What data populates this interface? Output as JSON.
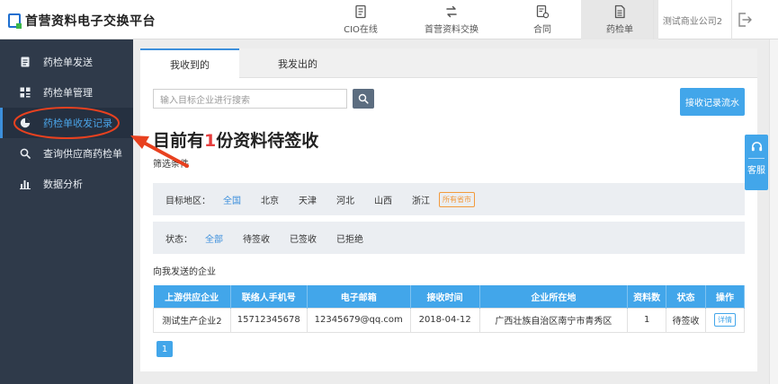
{
  "app": {
    "title": "首营资料电子交换平台"
  },
  "topnav": [
    {
      "label": "CIO在线",
      "icon": "document-icon"
    },
    {
      "label": "首营资料交换",
      "icon": "exchange-icon"
    },
    {
      "label": "合同",
      "icon": "contract-icon"
    },
    {
      "label": "药检单",
      "icon": "report-icon",
      "active": true
    }
  ],
  "account": {
    "company": "测试商业公司2"
  },
  "sidebar": {
    "items": [
      {
        "label": "药检单发送",
        "icon": "file-icon"
      },
      {
        "label": "药检单管理",
        "icon": "grid-icon"
      },
      {
        "label": "药检单收发记录",
        "icon": "pie-chart-icon",
        "active": true
      },
      {
        "label": "查询供应商药检单",
        "icon": "search-icon"
      },
      {
        "label": "数据分析",
        "icon": "bar-chart-icon"
      }
    ]
  },
  "tabs": [
    {
      "label": "我收到的",
      "active": true
    },
    {
      "label": "我发出的"
    }
  ],
  "search": {
    "placeholder": "输入目标企业进行搜索"
  },
  "flow_button": {
    "label": "接收记录流水"
  },
  "headline": {
    "prefix": "目前有",
    "count": "1",
    "suffix": "份资料待签收"
  },
  "filters": {
    "title": "筛选条件",
    "region": {
      "label": "目标地区：",
      "options": [
        "全国",
        "北京",
        "天津",
        "河北",
        "山西",
        "浙江"
      ],
      "selected": "全国",
      "more": "所有省市"
    },
    "status": {
      "label": "状态：",
      "options": [
        "全部",
        "待签收",
        "已签收",
        "已拒绝"
      ],
      "selected": "全部"
    }
  },
  "table": {
    "title": "向我发送的企业",
    "headers": [
      "上游供应企业",
      "联络人手机号",
      "电子邮箱",
      "接收时间",
      "企业所在地",
      "资料数",
      "状态",
      "操作"
    ],
    "rows": [
      [
        "测试生产企业2",
        "15712345678",
        "12345679@qq.com",
        "2018-04-12",
        "广西壮族自治区南宁市青秀区",
        "1",
        "待签收",
        "详情"
      ]
    ]
  },
  "pagination": {
    "current": "1"
  },
  "customer_service": {
    "label": "客服"
  },
  "colors": {
    "accent": "#42a6ea",
    "sidebar_bg": "#2f3a4a",
    "highlight": "#e53c3c",
    "annotation": "#e8411f"
  }
}
